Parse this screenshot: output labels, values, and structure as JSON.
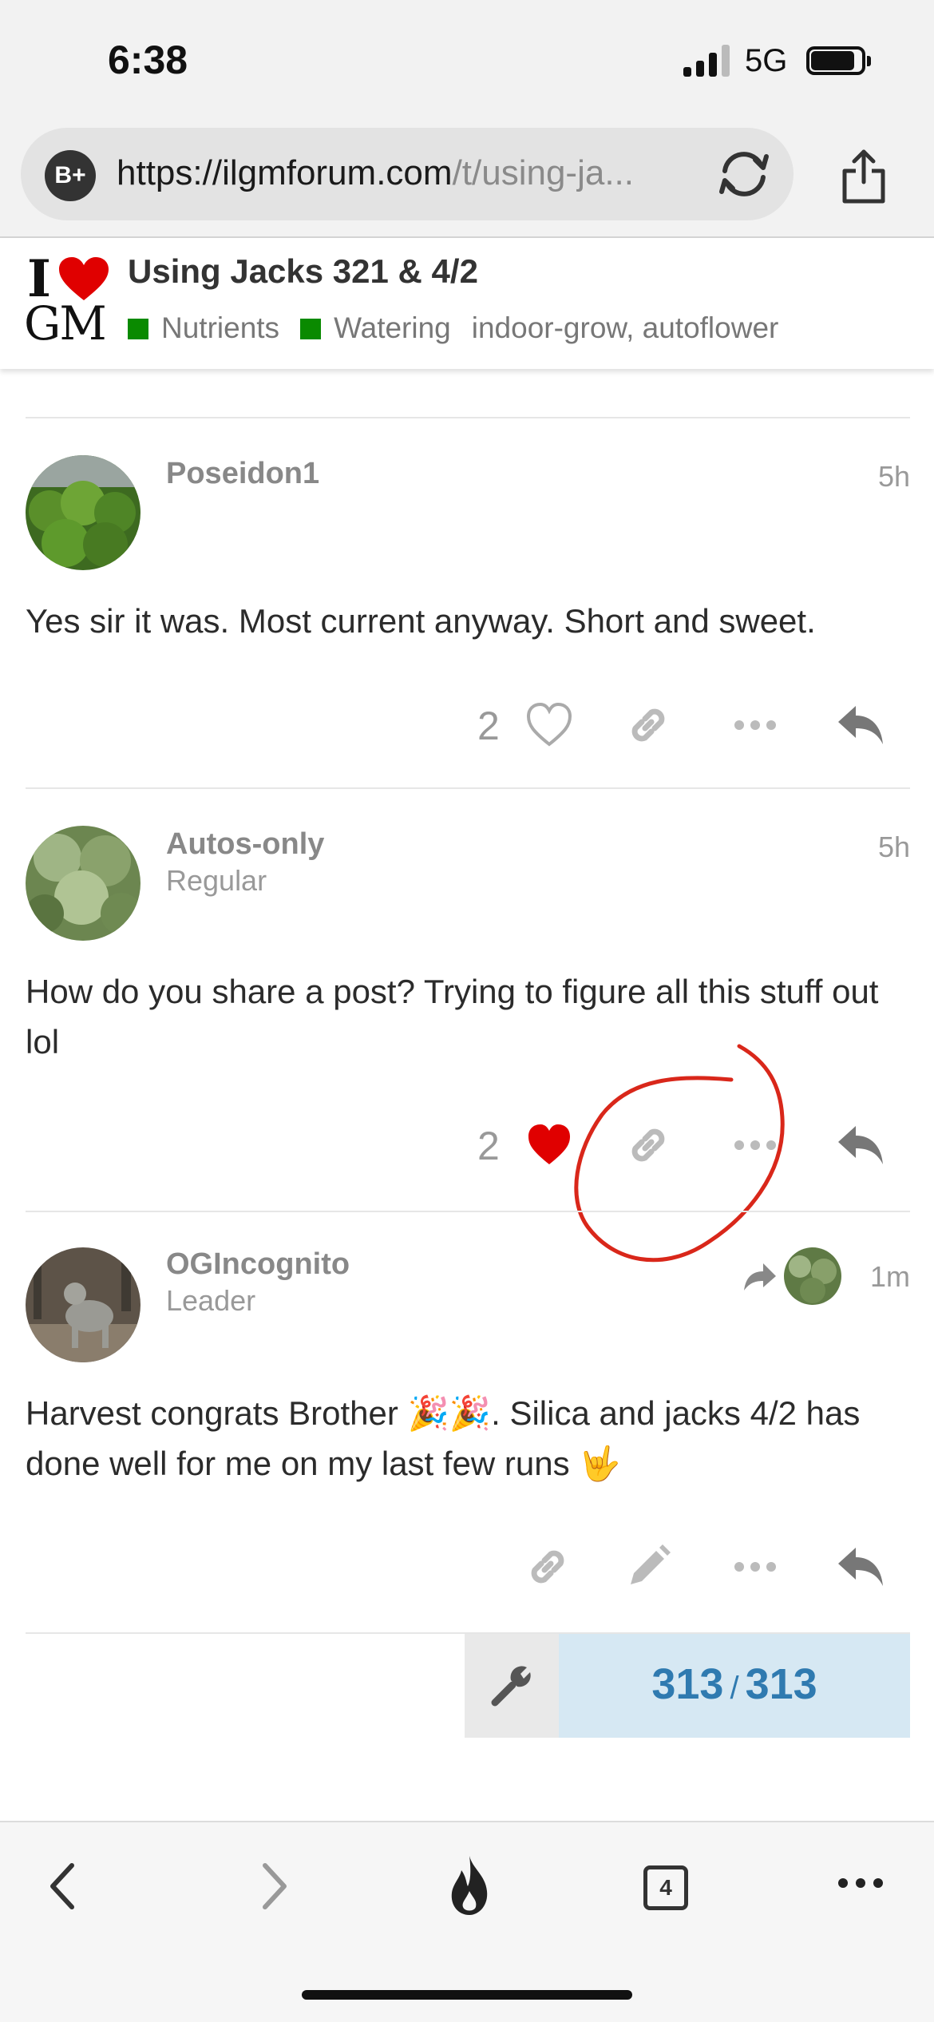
{
  "status_bar": {
    "time": "6:38",
    "network": "5G"
  },
  "browser": {
    "site_badge": "B+",
    "url_host": "https://ilgmforum.com",
    "url_path": "/t/using-ja..."
  },
  "topic": {
    "logo_top": "I",
    "logo_bottom": "GM",
    "title": "Using Jacks 321 & 4/2",
    "categories": [
      "Nutrients",
      "Watering"
    ],
    "tags": "indoor-grow, autoflower"
  },
  "posts": [
    {
      "username": "Poseidon1",
      "user_title": "",
      "time": "5h",
      "body": "Yes sir it was. Most current anyway. Short and sweet.",
      "likes": "2",
      "liked": false
    },
    {
      "username": "Autos-only",
      "user_title": "Regular",
      "time": "5h",
      "body": "How do you share a post? Trying to figure all this stuff out lol",
      "likes": "2",
      "liked": true
    },
    {
      "username": "OGIncognito",
      "user_title": "Leader",
      "time": "1m",
      "body": "Harvest congrats Brother 🎉🎉. Silica and jacks 4/2 has done well for me on my last few runs 🤟",
      "likes": "",
      "liked": false
    }
  ],
  "progress": {
    "current": "313",
    "separator": "/",
    "total": "313"
  },
  "toolbar": {
    "tabs_count": "4"
  },
  "colors": {
    "heart": "#e00000",
    "annotation": "#d9271a",
    "category": "#0a8a00",
    "progress_text": "#2f7ab0",
    "progress_bg": "#d6e8f3"
  },
  "icons": [
    "signal-icon",
    "battery-icon",
    "reload-icon",
    "share-icon",
    "heart-icon",
    "link-icon",
    "more-icon",
    "reply-icon",
    "edit-icon",
    "wrench-icon",
    "back-icon",
    "forward-icon",
    "flame-icon",
    "tabs-icon"
  ]
}
